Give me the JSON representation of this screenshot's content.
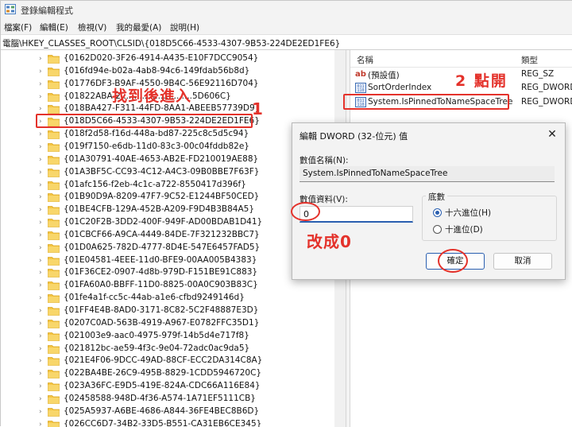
{
  "window": {
    "title": "登錄編輯程式"
  },
  "menu": [
    "檔案(F)",
    "編輯(E)",
    "檢視(V)",
    "我的最愛(A)",
    "說明(H)"
  ],
  "address": "電腦\\HKEY_CLASSES_ROOT\\CLSID\\{018D5C66-4533-4307-9B53-224DE2ED1FE6}",
  "tree": {
    "items": [
      "{0162D020-3F26-4914-A435-E10F7DCC9054}",
      "{016fd94e-b02a-4ab8-94c6-149fdab56b8d}",
      "{01776DF3-B9AF-4550-9B4C-56E92116D704}",
      "{01822ABA-2...........................5D606C}",
      "{018BA427-F311-44FD-8AA1-ABEEB57739D9}",
      "{018D5C66-4533-4307-9B53-224DE2ED1FE6}",
      "{018f2d58-f16d-448a-bd87-225c8c5d5c94}",
      "{019f7150-e6db-11d0-83c3-00c04fddb82e}",
      "{01A30791-40AE-4653-AB2E-FD210019AE88}",
      "{01A3BF5C-CC93-4C12-A4C3-09B0BBE7F63F}",
      "{01afc156-f2eb-4c1c-a722-8550417d396f}",
      "{01B90D9A-8209-47F7-9C52-E1244BF50CED}",
      "{01BE4CFB-129A-452B-A209-F9D4B3B84A5}",
      "{01C20F2B-3DD2-400F-949F-AD00BDAB1D41}",
      "{01CBCF66-A9CA-4449-84DE-7F321232BBC7}",
      "{01D0A625-782D-4777-8D4E-547E6457FAD5}",
      "{01E04581-4EEE-11d0-BFE9-00AA005B4383}",
      "{01F36CE2-0907-4d8b-979D-F151BE91C883}",
      "{01FA60A0-BBFF-11D0-8825-00A0C903B83C}",
      "{01fe4a1f-cc5c-44ab-a1e6-cfbd9249146d}",
      "{01FF4E4B-8AD0-3171-8C82-5C2F48887E3D}",
      "{0207C0AD-563B-4919-A967-E0782FFC35D1}",
      "{021003e9-aac0-4975-979f-14b5d4e717f8}",
      "{021812bc-ae59-4f3c-9e04-72adc0ac9da5}",
      "{021E4F06-9DCC-49AD-88CF-ECC2DA314C8A}",
      "{022BA4BE-26C9-495B-8829-1CDD5946720C}",
      "{023A36FC-E9D5-419E-824A-CDC66A116E84}",
      "{02458588-948D-4f36-A574-1A71EF5111CB}",
      "{025A5937-A6BE-4686-A844-36FE4BEC8B6D}",
      "{026CC6D7-34B2-33D5-B551-CA31EB6CE345}"
    ],
    "selected_index": 5
  },
  "annotations": {
    "step1_text": "找到後進入",
    "step1_num": "1",
    "step2_text": "2 點開",
    "step3_text": "改成0"
  },
  "values_pane": {
    "col_name": "名稱",
    "col_type": "類型",
    "rows": [
      {
        "icon": "string-value-icon",
        "name": "(預設值)",
        "type": "REG_SZ"
      },
      {
        "icon": "binary-value-icon",
        "name": "SortOrderIndex",
        "type": "REG_DWORD"
      },
      {
        "icon": "binary-value-icon",
        "name": "System.IsPinnedToNameSpaceTree",
        "type": "REG_DWORD"
      }
    ]
  },
  "dialog": {
    "title": "編輯 DWORD (32-位元) 值",
    "close": "✕",
    "value_name_label": "數值名稱(N):",
    "value_name": "System.IsPinnedToNameSpaceTree",
    "value_data_label": "數值資料(V):",
    "value_data": "0",
    "base_label": "底數",
    "base_options": [
      "十六進位(H)",
      "十進位(D)"
    ],
    "base_selected": "十六進位(H)",
    "ok": "確定",
    "cancel": "取消"
  },
  "colors": {
    "annotation": "#e4322b",
    "folder": "#f5c542",
    "accent": "#2a5fb0"
  }
}
